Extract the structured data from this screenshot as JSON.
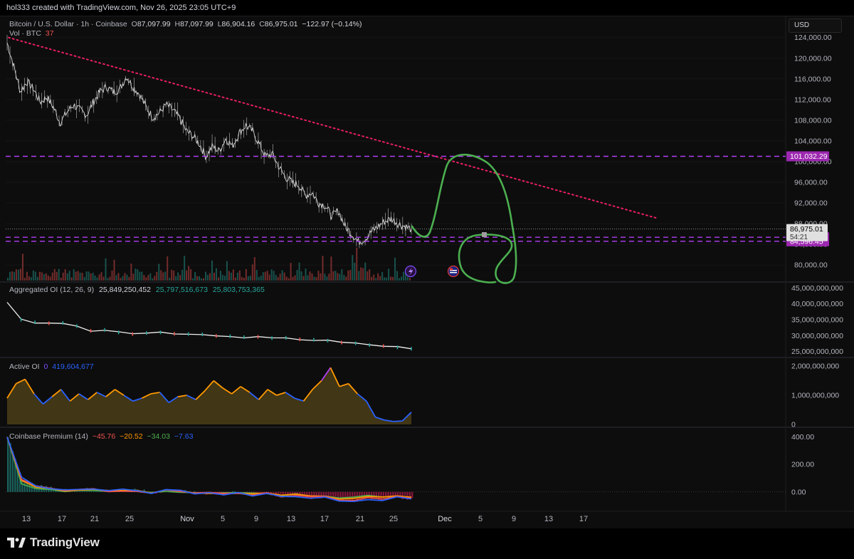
{
  "header": {
    "attribution": "hol333 created with TradingView.com, Nov 26, 2025 23:05 UTC+9"
  },
  "main_legend": {
    "symbol": "Bitcoin / U.S. Dollar · 1h · Coinbase",
    "o_label": "O",
    "o": "87,097.99",
    "h_label": "H",
    "h": "87,097.99",
    "l_label": "L",
    "l": "86,904.16",
    "c_label": "C",
    "c": "86,975.01",
    "change": "−122.97 (−0.14%)"
  },
  "vol_legend": {
    "label": "Vol · BTC",
    "value": "37"
  },
  "currency_button": "USD",
  "brand": "TradingView",
  "colors": {
    "up": "#26a69a",
    "down": "#ef5350",
    "purple": "#b03ff2",
    "trendline": "#e91e63",
    "annotation": "#4caf50",
    "price_label_bg": "#9c27b0"
  },
  "chart_data": [
    {
      "type": "line",
      "title": "Bitcoin / U.S. Dollar · 1h · Coinbase",
      "x_ticks": [
        "13",
        "17",
        "21",
        "25",
        "Nov",
        "5",
        "9",
        "13",
        "17",
        "21",
        "25",
        "Dec",
        "5",
        "9",
        "13",
        "17"
      ],
      "y_ticks": [
        "80,000.00",
        "84,000.00",
        "88,000.00",
        "92,000.00",
        "96,000.00",
        "100,000.00",
        "104,000.00",
        "108,000.00",
        "112,000.00",
        "116,000.00",
        "120,000.00",
        "124,000.00"
      ],
      "ylim": [
        77000,
        125200
      ],
      "series": [
        {
          "values": [
            123000,
            118500,
            113500,
            115500,
            114000,
            111500,
            112500,
            110500,
            107500,
            109500,
            111000,
            110000,
            109000,
            111500,
            113500,
            114500,
            113500,
            114000,
            116500,
            114500,
            113000,
            110500,
            108500,
            109500,
            111000,
            110000,
            108500,
            106000,
            105000,
            103500,
            101000,
            103000,
            102000,
            104500,
            103000,
            105500,
            107000,
            106000,
            103500,
            101000,
            101500,
            99000,
            97000,
            96000,
            95500,
            93500,
            94000,
            92000,
            91500,
            89500,
            90500,
            87500,
            86000,
            84500,
            85000,
            86500,
            87500,
            88500,
            89000,
            88000,
            87500,
            86975
          ]
        }
      ],
      "horizontal_levels": [
        {
          "label": "101,032.29",
          "value": 101032.29
        },
        {
          "label": "85,371.51",
          "value": 85371.51
        },
        {
          "label": "84,596.45",
          "value": 84596.45
        }
      ],
      "last_price": {
        "label": "86,975.01",
        "countdown": "54:21",
        "value": 86975.01
      },
      "trendline": {
        "from": {
          "x": "Oct 11",
          "y": 124000
        },
        "to": {
          "x": "Dec 12",
          "y": 89000
        },
        "style": "dotted"
      }
    },
    {
      "type": "line",
      "title": "Aggregated OI (12, 26, 9)",
      "legend_values": [
        "25,849,250,452",
        "25,797,516,673",
        "25,803,753,365"
      ],
      "y_ticks": [
        "25,000,000,000",
        "30,000,000,000",
        "35,000,000,000",
        "40,000,000,000",
        "45,000,000,000"
      ],
      "ylim": [
        24000000000,
        46000000000
      ],
      "series": [
        {
          "values": [
            40500000000,
            35000000000,
            34200000000,
            33900000000,
            34000000000,
            33000000000,
            31500000000,
            31800000000,
            31000000000,
            30500000000,
            30800000000,
            31000000000,
            30600000000,
            30500000000,
            30400000000,
            29900000000,
            29800000000,
            29500000000,
            29600000000,
            29200000000,
            29300000000,
            28800000000,
            28700000000,
            28400000000,
            27800000000,
            27600000000,
            27000000000,
            26700000000,
            26300000000,
            25850000000
          ]
        }
      ]
    },
    {
      "type": "area",
      "title": "Active OI",
      "legend_values": [
        "0",
        "419,604,677"
      ],
      "y_ticks": [
        "0",
        "1,000,000,000",
        "2,000,000,000"
      ],
      "ylim": [
        0,
        2200000000
      ],
      "series": [
        {
          "values": [
            900000000,
            1400000000,
            1550000000,
            1050000000,
            700000000,
            950000000,
            1200000000,
            800000000,
            1050000000,
            850000000,
            1100000000,
            950000000,
            1200000000,
            1000000000,
            800000000,
            900000000,
            1050000000,
            1100000000,
            750000000,
            950000000,
            1000000000,
            850000000,
            1150000000,
            1500000000,
            1250000000,
            1050000000,
            1300000000,
            1100000000,
            850000000,
            1200000000,
            1000000000,
            1100000000,
            900000000,
            800000000,
            1200000000,
            1500000000,
            1950000000,
            1300000000,
            1400000000,
            1050000000,
            800000000,
            250000000,
            150000000,
            100000000,
            120000000,
            420000000
          ]
        }
      ]
    },
    {
      "type": "area",
      "title": "Coinbase Premium (14)",
      "legend_values": [
        "−45.76",
        "−20.52",
        "−34.03",
        "−7.63"
      ],
      "y_ticks": [
        "0.00",
        "200.00",
        "400.00"
      ],
      "ylim": [
        -110,
        450
      ],
      "series": [
        {
          "values": [
            400,
            90,
            40,
            25,
            10,
            15,
            20,
            5,
            12,
            8,
            -5,
            10,
            5,
            -10,
            -8,
            -15,
            -5,
            -20,
            -10,
            -30,
            -25,
            -40,
            -35,
            -55,
            -60,
            -45,
            -50,
            -35,
            -46
          ]
        }
      ]
    }
  ]
}
